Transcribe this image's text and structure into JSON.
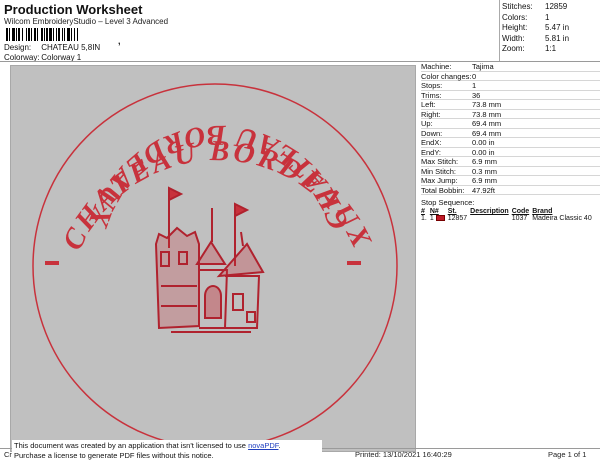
{
  "header": {
    "title": "Production Worksheet",
    "subtitle": "Wilcom EmbroideryStudio – Level 3 Advanced",
    "barcode_suffix": ",",
    "design_label": "Design:",
    "design_value": "CHATEAU 5,8IN",
    "colorway_label": "Colorway:",
    "colorway_value": "Colorway 1"
  },
  "stats": [
    {
      "label": "Stitches:",
      "value": "12859"
    },
    {
      "label": "Colors:",
      "value": "1"
    },
    {
      "label": "Height:",
      "value": "5.47 in"
    },
    {
      "label": "Width:",
      "value": "5.81 in"
    },
    {
      "label": "Zoom:",
      "value": "1:1"
    }
  ],
  "machine": [
    {
      "label": "Machine:",
      "value": "Tajima"
    },
    {
      "label": "Color changes:",
      "value": "0"
    },
    {
      "label": "Stops:",
      "value": "1"
    },
    {
      "label": "Trims:",
      "value": "36"
    },
    {
      "label": "Left:",
      "value": "73.8 mm"
    },
    {
      "label": "Right:",
      "value": "73.8 mm"
    },
    {
      "label": "Up:",
      "value": "69.4 mm"
    },
    {
      "label": "Down:",
      "value": "69.4 mm"
    },
    {
      "label": "EndX:",
      "value": "0.00 in"
    },
    {
      "label": "EndY:",
      "value": "0.00 in"
    },
    {
      "label": "Max Stitch:",
      "value": "6.9 mm"
    },
    {
      "label": "Min Stitch:",
      "value": "0.3 mm"
    },
    {
      "label": "Max Jump:",
      "value": "6.9 mm"
    },
    {
      "label": "Total Bobbin:",
      "value": "47.92ft"
    }
  ],
  "stop_sequence": {
    "title": "Stop Sequence:",
    "headers": [
      "#",
      "N#",
      "St.",
      "Description",
      "Code",
      "Brand"
    ],
    "rows": [
      {
        "num": "1.",
        "n": "1",
        "st": "12857",
        "description": "",
        "code": "1037",
        "brand": "Madeira Classic 40",
        "color": "#c01a28"
      }
    ]
  },
  "design": {
    "text_top": "CHATEAU BORDEAUX",
    "text_bottom": "CHATEAU BORDEAUX",
    "thread_color": "#c8323c",
    "background": "#c0c0c0"
  },
  "notice": {
    "line1": "This document was created by an application that isn't licensed to use ",
    "link": "novaPDF",
    "line1_end": ".",
    "line2": "Purchase a license to generate PDF files without this notice."
  },
  "footer": {
    "left": "Cr",
    "printed": "Printed: 13/10/2021 16:40:29",
    "page": "Page 1 of 1"
  }
}
